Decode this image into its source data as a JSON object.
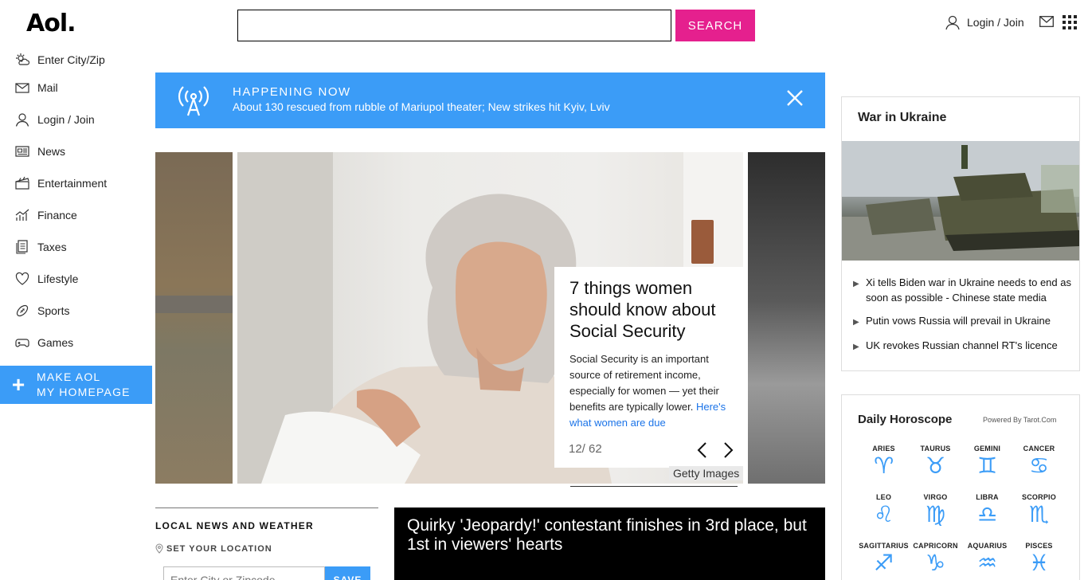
{
  "header": {
    "logo": "Aol.",
    "search_placeholder": "",
    "search_button": "SEARCH",
    "login": "Login / Join"
  },
  "sidebar": {
    "items": [
      {
        "label": "Enter City/Zip",
        "icon": "weather-icon"
      },
      {
        "label": "Mail",
        "icon": "mail-icon"
      },
      {
        "label": "Login / Join",
        "icon": "user-icon"
      },
      {
        "label": "News",
        "icon": "news-icon"
      },
      {
        "label": "Entertainment",
        "icon": "clapper-icon"
      },
      {
        "label": "Finance",
        "icon": "chart-icon"
      },
      {
        "label": "Taxes",
        "icon": "document-icon"
      },
      {
        "label": "Lifestyle",
        "icon": "heart-icon"
      },
      {
        "label": "Sports",
        "icon": "football-icon"
      },
      {
        "label": "Games",
        "icon": "gamepad-icon"
      }
    ],
    "make_home_line1": "MAKE AOL",
    "make_home_line2": "MY HOMEPAGE"
  },
  "happening": {
    "kicker": "HAPPENING NOW",
    "headline": "About 130 rescued from rubble of Mariupol theater; New strikes hit Kyiv, Lviv"
  },
  "carousel": {
    "title": "7 things women should know about Social Security",
    "description": "Social Security is an important source of retirement income, especially for women — yet their benefits are typically lower.",
    "more_link": "Here's what women are due",
    "counter": "12/ 62",
    "credit": "Getty Images"
  },
  "local": {
    "heading": "LOCAL NEWS AND WEATHER",
    "set_location": "SET YOUR LOCATION",
    "zip_placeholder": "Enter City or Zipcode",
    "save": "SAVE"
  },
  "video": {
    "title": "Quirky 'Jeopardy!' contestant finishes in 3rd place, but 1st in viewers' hearts"
  },
  "war": {
    "heading": "War in Ukraine",
    "items": [
      "Xi tells Biden war in Ukraine needs to end as soon as possible - Chinese state media",
      "Putin vows Russia will prevail in Ukraine",
      "UK revokes Russian channel RT's licence"
    ]
  },
  "horoscope": {
    "heading": "Daily Horoscope",
    "powered": "Powered By Tarot.Com",
    "signs": [
      {
        "name": "ARIES",
        "glyph": "♈"
      },
      {
        "name": "TAURUS",
        "glyph": "♉"
      },
      {
        "name": "GEMINI",
        "glyph": "♊"
      },
      {
        "name": "CANCER",
        "glyph": "♋"
      },
      {
        "name": "LEO",
        "glyph": "♌"
      },
      {
        "name": "VIRGO",
        "glyph": "♍"
      },
      {
        "name": "LIBRA",
        "glyph": "♎"
      },
      {
        "name": "SCORPIO",
        "glyph": "♏"
      },
      {
        "name": "SAGITTARIUS",
        "glyph": "♐"
      },
      {
        "name": "CAPRICORN",
        "glyph": "♑"
      },
      {
        "name": "AQUARIUS",
        "glyph": "♒"
      },
      {
        "name": "PISCES",
        "glyph": "♓"
      }
    ]
  },
  "colors": {
    "accent_blue": "#3b9cf7",
    "search_pink": "#e5208e"
  }
}
